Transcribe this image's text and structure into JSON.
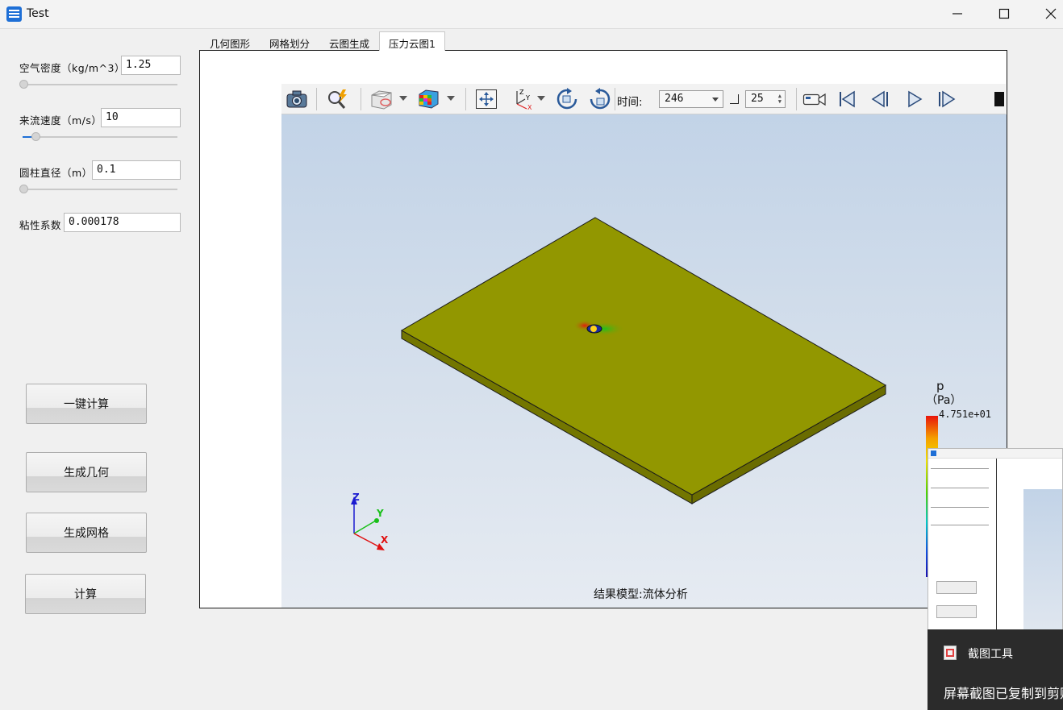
{
  "window": {
    "title": "Test",
    "minimize_icon": "minimize-icon",
    "maximize_icon": "maximize-icon",
    "close_icon": "close-icon"
  },
  "params": {
    "density_label": "空气密度（kg/m^3）",
    "density_value": "1.25",
    "velocity_label": "来流速度（m/s）",
    "velocity_value": "10",
    "diameter_label": "圆柱直径（m）",
    "diameter_value": "0.1",
    "viscosity_label": "粘性系数",
    "viscosity_value": "0.000178"
  },
  "buttons": {
    "one_click": "一键计算",
    "gen_geometry": "生成几何",
    "gen_mesh": "生成网格",
    "compute": "计算"
  },
  "tabs": [
    "几何图形",
    "网格划分",
    "云图生成",
    "压力云图1"
  ],
  "active_tab": 3,
  "toolbar": {
    "time_label": "时间:",
    "time_value": "246",
    "step_value": "25",
    "icons": [
      "camera-icon",
      "zoom-flash-icon",
      "cube-view-icon",
      "color-cube-icon",
      "fit-view-icon",
      "axes-icon",
      "rotate-cw-icon",
      "rotate-ccw-icon",
      "video-icon",
      "first-frame-icon",
      "prev-frame-icon",
      "play-icon",
      "next-frame-icon"
    ]
  },
  "viewport": {
    "caption": "结果模型:流体分析",
    "plate_color": "#929700",
    "axis_labels": {
      "x": "X",
      "y": "Y",
      "z": "Z"
    }
  },
  "legend": {
    "title": "p",
    "unit": "（Pa）",
    "max_label": "4.751e+01"
  },
  "toast": {
    "title": "截图工具",
    "body": "屏幕截图已复制到剪贴板"
  }
}
